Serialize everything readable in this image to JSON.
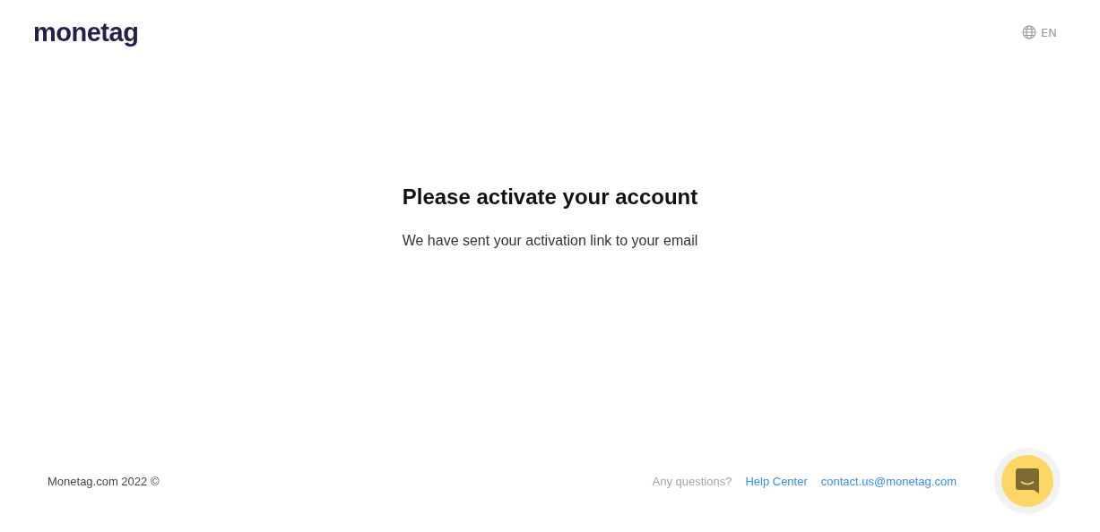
{
  "header": {
    "logo": "monetag",
    "language": "EN"
  },
  "message": {
    "title": "Please activate your account",
    "text": "We have sent your activation link to your email"
  },
  "footer": {
    "copyright": "Monetag.com 2022 ©",
    "question": "Any questions?",
    "links": [
      "Help Center",
      "contact.us@monetag.com"
    ]
  }
}
